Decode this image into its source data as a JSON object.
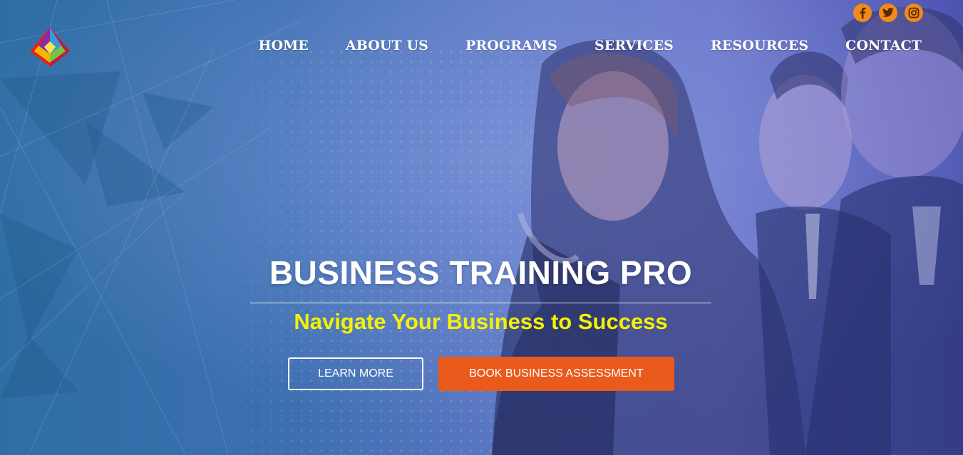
{
  "header": {
    "logo_name": "logo",
    "social": [
      {
        "icon": "facebook-icon",
        "label": "f"
      },
      {
        "icon": "twitter-icon",
        "label": ""
      },
      {
        "icon": "instagram-icon",
        "label": ""
      }
    ],
    "nav": [
      {
        "label": "HOME"
      },
      {
        "label": "ABOUT US"
      },
      {
        "label": "PROGRAMS"
      },
      {
        "label": "SERVICES"
      },
      {
        "label": "RESOURCES"
      },
      {
        "label": "CONTACT"
      }
    ]
  },
  "hero": {
    "title": "BUSINESS TRAINING PRO",
    "subtitle": "Navigate Your Business to Success",
    "learn_more_label": "LEARN MORE",
    "book_label": "BOOK BUSINESS ASSESSMENT"
  },
  "colors": {
    "accent_orange": "#ea5a1c",
    "social_orange": "#f08a1c",
    "subtitle_yellow": "#f5f200",
    "hero_blue": "#3c6fb0"
  }
}
